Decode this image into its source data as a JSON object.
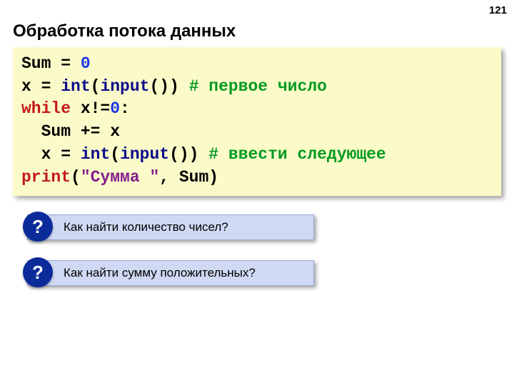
{
  "page_number": "121",
  "title": "Обработка потока данных",
  "code": {
    "l1": {
      "a": "Sum = ",
      "b": "0"
    },
    "l2": {
      "a": "x = ",
      "b": "int",
      "c": "(",
      "d": "input",
      "e": "()) ",
      "f": "# первое число"
    },
    "l3": {
      "a": "while",
      "b": " x!=",
      "c": "0",
      "d": ":"
    },
    "l4": {
      "a": "  Sum += x"
    },
    "l5": {
      "a": "  x = ",
      "b": "int",
      "c": "(",
      "d": "input",
      "e": "()) ",
      "f": "# ввести следующее"
    },
    "l6": {
      "a": "print",
      "b": "(",
      "c": "\"Сумма \"",
      "d": ", Sum)"
    }
  },
  "questions": {
    "mark": "?",
    "q1": "Как найти количество чисел?",
    "q2": "Как найти сумму положительных?"
  }
}
